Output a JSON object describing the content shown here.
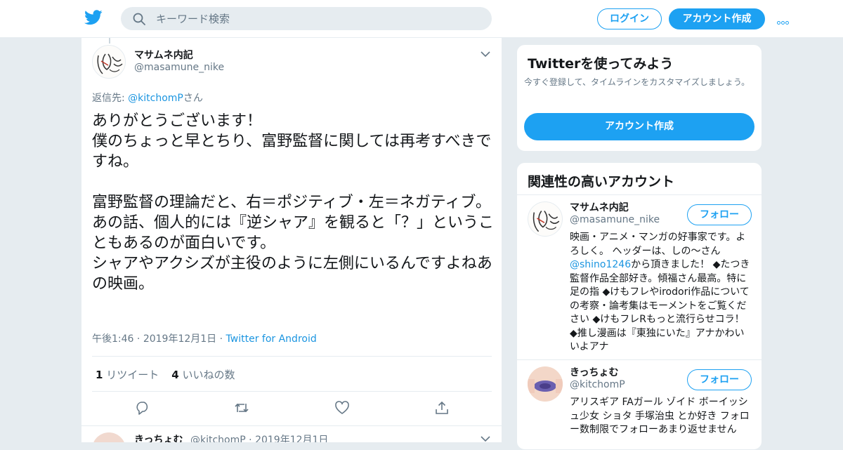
{
  "header": {
    "search_placeholder": "キーワード検索",
    "login_label": "ログイン",
    "signup_label": "アカウント作成"
  },
  "tweet": {
    "author_name": "マサムネ内記",
    "author_handle": "@masamune_nike",
    "reply_prefix": "返信先: ",
    "reply_target": "@kitchomP",
    "reply_suffix": "さん",
    "body": "ありがとうございます！\n僕のちょっと早とちり、富野監督に関しては再考すべきですね。\n\n富野監督の理論だと、右＝ポジティブ・左＝ネガティブ。\nあの話、個人的には『逆シャア』を観ると「？」ということもあるのが面白いです。\nシャアやアクシズが主役のように左側にいるんですよねあの映画。",
    "time": "午後1:46",
    "date": "2019年12月1日",
    "source": "Twitter for Android",
    "retweet_count": "1",
    "retweet_label": "リツイート",
    "like_count": "4",
    "like_label": "いいねの数"
  },
  "next_tweet": {
    "author_name": "きっちょむ",
    "author_handle": "@kitchomP",
    "date": "2019年12月1日"
  },
  "sidebar": {
    "signup_card": {
      "title": "Twitterを使ってみよう",
      "subtitle": "今すぐ登録して、タイムラインをカスタマイズしましょう。",
      "cta_label": "アカウント作成"
    },
    "related": {
      "title": "関連性の高いアカウント",
      "follow_label": "フォロー",
      "accounts": [
        {
          "name": "マサムネ内記",
          "handle": "@masamune_nike",
          "bio_before": "映画・アニメ・マンガの好事家です。よろしく。 ヘッダーは、しの〜さん",
          "bio_link": "@shino1246",
          "bio_after": "から頂きました！ ◆たつき監督作品全部好き。傾福さん最高。特に足の指 ◆けもフレやirodori作品についての考察・論考集はモーメントをご覧ください ◆けもフレRもっと流行らせコラ！ ◆推し漫画は『東独にいた』アナかわいいよアナ"
        },
        {
          "name": "きっちょむ",
          "handle": "@kitchomP",
          "bio": "アリスギア FAガール ゾイド ボーイッシュ少女 ショタ 手塚治虫 とか好き フォロー数制限でフォローあまり返せません"
        }
      ]
    }
  },
  "colors": {
    "brand": "#1da1f2",
    "link": "#1b95e0",
    "muted": "#657786",
    "background": "#e6ecf0"
  },
  "icons": [
    "twitter-bird-icon",
    "search-icon",
    "more-dots-icon",
    "chevron-down-icon",
    "reply-icon",
    "retweet-icon",
    "like-heart-icon",
    "share-icon"
  ]
}
